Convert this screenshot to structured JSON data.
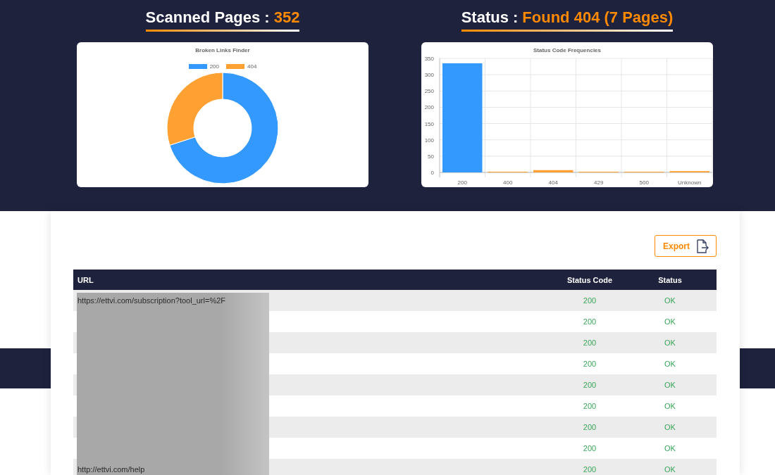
{
  "summaries": [
    {
      "label": "Scanned Pages :",
      "value": "352"
    },
    {
      "label": "Status :",
      "value": "Found 404 (7 Pages)"
    }
  ],
  "donut_card": {
    "chart_data": {
      "type": "donut",
      "title": "Broken Links Finder",
      "categories": [
        "200",
        "404"
      ],
      "values": [
        70,
        30
      ],
      "colors": [
        "#3399ff",
        "#ffa033"
      ],
      "legend": "top"
    }
  },
  "bar_card": {
    "chart_data": {
      "type": "bar",
      "title": "Status Code Frequencies",
      "categories": [
        "200",
        "400",
        "404",
        "429",
        "500",
        "Unknown"
      ],
      "values": [
        335,
        0,
        7,
        0,
        2,
        4
      ],
      "colors": [
        "#3399ff",
        "#ffa033",
        "#ffa033",
        "#ffa033",
        "#ffa033",
        "#ffa033"
      ],
      "ylim": [
        0,
        350
      ],
      "grid": true,
      "yticks": [
        0,
        50,
        100,
        150,
        200,
        250,
        300,
        350
      ]
    }
  },
  "export_button": {
    "label": "Export"
  },
  "table": {
    "columns": [
      "URL",
      "Status Code",
      "Status"
    ],
    "rows": [
      {
        "url": "https://ettvi.com/subscription?tool_url=%2F",
        "status_code": "200",
        "status": "OK"
      },
      {
        "status_code": "200",
        "status": "OK"
      },
      {
        "status_code": "200",
        "status": "OK"
      },
      {
        "status_code": "200",
        "status": "OK"
      },
      {
        "status_code": "200",
        "status": "OK"
      },
      {
        "status_code": "200",
        "status": "OK"
      },
      {
        "status_code": "200",
        "status": "OK"
      },
      {
        "status_code": "200",
        "status": "OK"
      },
      {
        "url": "http://ettvi.com/help",
        "status_code": "200",
        "status": "OK"
      }
    ]
  }
}
